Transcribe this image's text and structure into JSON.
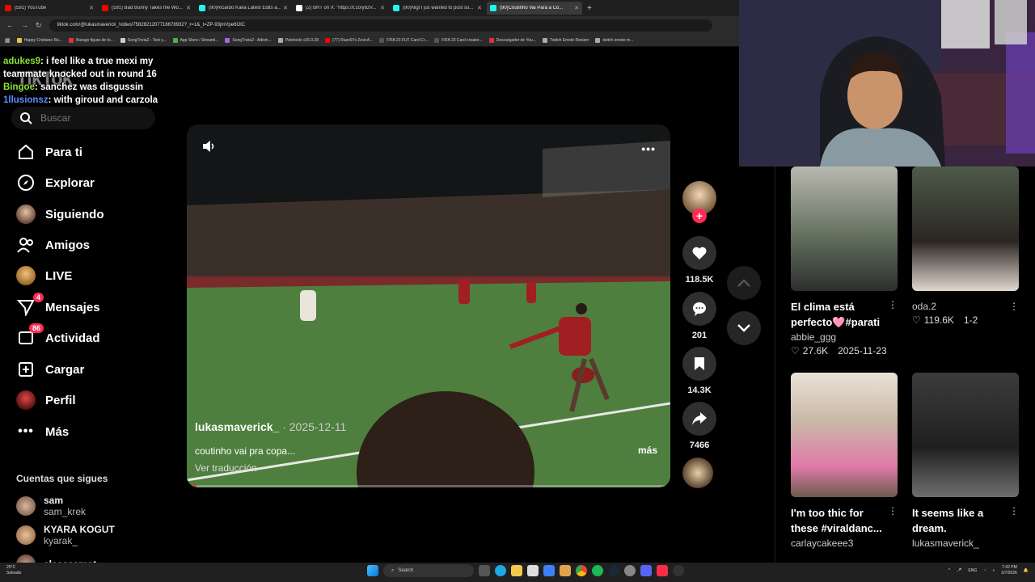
{
  "browser": {
    "tabs": [
      {
        "title": "(591) YouTube",
        "color": "#ff0000"
      },
      {
        "title": "(591) Bad Bunny Takes the Wo...",
        "color": "#ff0000"
      },
      {
        "title": "(90)Ricardo Kaká Latest Edits a...",
        "color": "#25f4ee"
      },
      {
        "title": "(2) BRT on X: \"https://t.co/y6zV...",
        "color": "#ffffff"
      },
      {
        "title": "(90)Nigl I jus wanted to post so...",
        "color": "#25f4ee"
      },
      {
        "title": "(90)Coutinho Vai Para a Co...",
        "color": "#25f4ee",
        "active": true
      }
    ],
    "new_tab": "+",
    "url": "tiktok.com/@lukasmaverick_/video/7582821207716678932?_r=1&_t=ZP-93jmVpe6OIC",
    "bookmarks": [
      {
        "label": "Happy Cristiano Ro...",
        "color": "#e4c04b"
      },
      {
        "label": "Burago figura de to...",
        "color": "#d33"
      },
      {
        "label": "SongTrivia2 - Test y...",
        "color": "#ccc"
      },
      {
        "label": "App Store / Streaml...",
        "color": "#4caf50"
      },
      {
        "label": "SongTrivia2 - Adivin...",
        "color": "#9c6ade"
      },
      {
        "label": "Peletools v26.0.28",
        "color": "#aaa"
      },
      {
        "label": "(77) Razo97s Zest-A...",
        "color": "#ff0000"
      },
      {
        "label": "FIFA 23 FUT Card Cr...",
        "color": "#555"
      },
      {
        "label": "FIFA 23 Card creator...",
        "color": "#555"
      },
      {
        "label": "Descargador de You...",
        "color": "#d33"
      },
      {
        "label": "Twitch Emote Resizer",
        "color": "#aaa"
      },
      {
        "label": "twitch emote m...",
        "color": "#aaa"
      }
    ]
  },
  "sidebar": {
    "logo": "TikTok",
    "search_placeholder": "Buscar",
    "nav": [
      {
        "label": "Para ti",
        "icon": "home-icon"
      },
      {
        "label": "Explorar",
        "icon": "compass-icon"
      },
      {
        "label": "Siguiendo",
        "icon": "following-avatar"
      },
      {
        "label": "Amigos",
        "icon": "friends-icon"
      },
      {
        "label": "LIVE",
        "icon": "live-avatar"
      },
      {
        "label": "Mensajes",
        "icon": "messages-icon",
        "badge": "4"
      },
      {
        "label": "Actividad",
        "icon": "activity-icon",
        "badge": "86"
      },
      {
        "label": "Cargar",
        "icon": "upload-icon"
      },
      {
        "label": "Perfil",
        "icon": "profile-avatar"
      },
      {
        "label": "Más",
        "icon": "more-icon"
      }
    ],
    "following_title": "Cuentas que sigues",
    "accounts": [
      {
        "name": "sam",
        "handle": "sam_krek"
      },
      {
        "name": "KYARA KOGUT",
        "handle": "kyarak_"
      },
      {
        "name": "alessaamot",
        "handle": ""
      }
    ]
  },
  "chat": [
    {
      "user": "adukes9",
      "user_color": "#8ae234",
      "text": ": i feel like a true mexi my teammate knocked out in round 16"
    },
    {
      "user": "Bingoe",
      "user_color": "#8ae234",
      "text": ": sanchez was disgussin"
    },
    {
      "user": "1llusionsz",
      "user_color": "#5b8cff",
      "text": ": with giroud and carzola"
    }
  ],
  "video": {
    "username": "lukasmaverick_",
    "date": " · 2025-12-11",
    "caption": "coutinho vai pra copa...",
    "translate": "Ver traducción",
    "more": "más",
    "progress": 0.02
  },
  "actions": {
    "likes": "118.5K",
    "comments": "201",
    "saves": "14.3K",
    "shares": "7466"
  },
  "feed": [
    {
      "title": "El clima está perfecto🩷#parati",
      "user": "abbie_ggg",
      "likes": "27.6K",
      "date": "2025-11-23",
      "bg": "linear-gradient(180deg,#b8b8b0,#5d6a58 60%,#2e2e2e)"
    },
    {
      "title": "",
      "user": "oda.2",
      "likes": "119.6K",
      "date": "1-2",
      "bg": "linear-gradient(180deg,#4e5a4a,#2b2622 60%,#e0d7cf)"
    },
    {
      "title": "I'm too thic for these #viraldanc...",
      "user": "carlaycakeee3",
      "likes": "",
      "date": "",
      "bg": "linear-gradient(180deg,#e9e3d8,#c9b7a6 40%,#e07aa9 75%,#6e5b4d)"
    },
    {
      "title": "It seems like a dream.",
      "user": "lukasmaverick_",
      "likes": "",
      "date": "",
      "bg": "linear-gradient(180deg,#3c3c3c,#1f1f1f 60%,#6f6f6f)"
    }
  ],
  "taskbar": {
    "temp": "25°C",
    "condition": "Soleado",
    "search": "Search",
    "lang": "ENG",
    "time": "7:42 PM",
    "date": "2/7/2026"
  },
  "colors": {
    "accent": "#fe2c55",
    "bg": "#000000",
    "button_bg": "#2f2f2f"
  }
}
